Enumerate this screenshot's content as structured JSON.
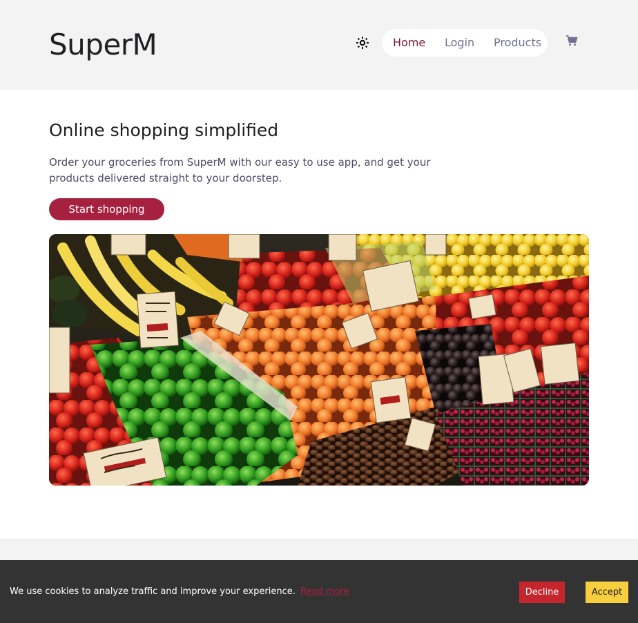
{
  "header": {
    "logo": "SuperM",
    "nav": {
      "home": "Home",
      "login": "Login",
      "products": "Products"
    },
    "icons": {
      "theme_toggle": "sun-icon",
      "cart": "cart-icon"
    }
  },
  "hero": {
    "title": "Online shopping simplified",
    "description": "Order your groceries from SuperM with our easy to use app, and get your products delivered straight to your doorstep.",
    "cta_label": "Start shopping",
    "image_subject": "produce-market-photo"
  },
  "cookie_banner": {
    "text": "We use cookies to analyze traffic and improve your experience.",
    "link_label": "Read more",
    "decline_label": "Decline",
    "accept_label": "Accept"
  },
  "colors": {
    "brand": "#a5213f",
    "active_nav": "#7a1934",
    "nav_text": "#6e7191",
    "header_bg": "#f3f3f3",
    "banner_bg": "#333333",
    "decline_bg": "#c5262e",
    "accept_bg": "#f7ce3e"
  }
}
